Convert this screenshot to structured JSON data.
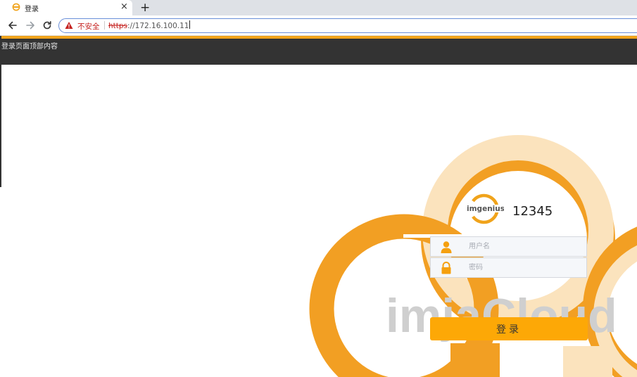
{
  "browser": {
    "tab_title": "登录",
    "tab_close": "×",
    "new_tab": "+",
    "security_label": "不安全",
    "url_scheme": "https",
    "url_rest": "://172.16.100.11"
  },
  "page": {
    "header_text": "登录页面顶部内容",
    "logo_text": "imgenius",
    "site_number": "12345",
    "watermark": "imjaCloud",
    "username_placeholder": "用户名",
    "password_placeholder": "密码",
    "login_label": "登录"
  },
  "colors": {
    "accent": "#f0a31b",
    "button": "#fda806",
    "header_bg": "#333333",
    "cloud_dark": "#f29f23",
    "cloud_light": "#fbe3bd"
  }
}
